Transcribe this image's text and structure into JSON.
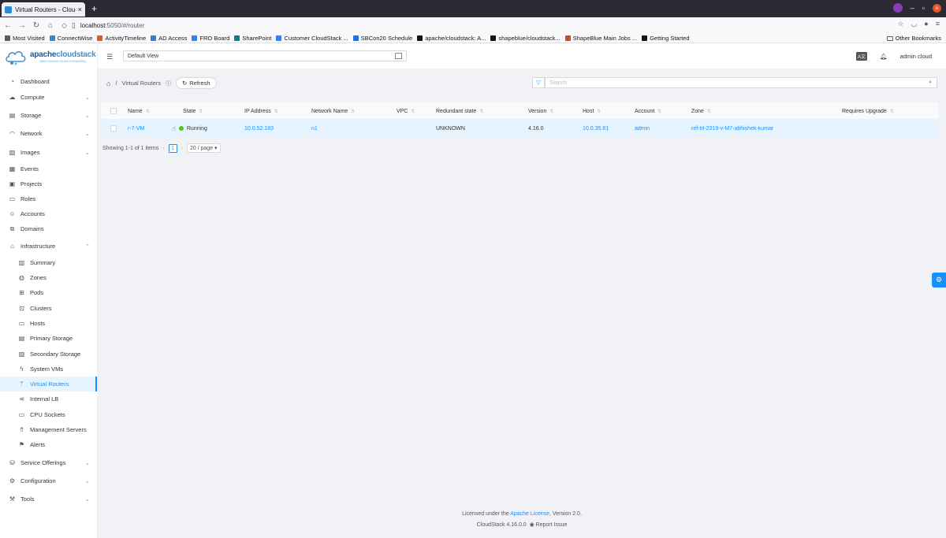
{
  "browser": {
    "tab_title": "Virtual Routers - CloudSt",
    "url_host": "localhost",
    "url_rest": ":5050/#/router",
    "bookmarks": [
      {
        "label": "Most Visited",
        "color": "#5b5b66"
      },
      {
        "label": "ConnectWise",
        "color": "#2a8dd4"
      },
      {
        "label": "ActivityTimeline",
        "color": "#e95420"
      },
      {
        "label": "AD Access",
        "color": "#3a7bd5"
      },
      {
        "label": "FRO Board",
        "color": "#2684ff"
      },
      {
        "label": "SharePoint",
        "color": "#038387"
      },
      {
        "label": "Customer CloudStack ...",
        "color": "#2684ff"
      },
      {
        "label": "SBCon20 Schedule",
        "color": "#1a73e8"
      },
      {
        "label": "apache/cloudstack: A...",
        "color": "#15141a"
      },
      {
        "label": "shapeblue/cloudstack...",
        "color": "#15141a"
      },
      {
        "label": "ShapeBlue Main Jobs ...",
        "color": "#d24726"
      },
      {
        "label": "Getting Started",
        "color": "#15141a"
      }
    ],
    "other_bookmarks": "Other Bookmarks"
  },
  "brand": {
    "logo_apache": "apache",
    "logo_cloudstack": "cloudstack",
    "logo_tagline": "open source cloud computing"
  },
  "header": {
    "view_label": "Default View",
    "user": "admin cloud",
    "lang_icon": "Ā"
  },
  "sidebar": {
    "items": [
      {
        "label": "Dashboard",
        "icon": "dashboard-icon",
        "glyph": "◔"
      },
      {
        "label": "Compute",
        "icon": "cloud-icon",
        "glyph": "☁"
      },
      {
        "label": "Storage",
        "icon": "database-icon",
        "glyph": "▤"
      },
      {
        "label": "Network",
        "icon": "wifi-icon",
        "glyph": "◠"
      },
      {
        "label": "Images",
        "icon": "picture-icon",
        "glyph": "▧"
      },
      {
        "label": "Events",
        "icon": "schedule-icon",
        "glyph": "▦"
      },
      {
        "label": "Projects",
        "icon": "project-icon",
        "glyph": "▣"
      },
      {
        "label": "Roles",
        "icon": "idcard-icon",
        "glyph": "▭"
      },
      {
        "label": "Accounts",
        "icon": "team-icon",
        "glyph": "☺"
      },
      {
        "label": "Domains",
        "icon": "block-icon",
        "glyph": "⧉"
      },
      {
        "label": "Infrastructure",
        "icon": "bank-icon",
        "glyph": "⌂"
      },
      {
        "label": "Summary",
        "icon": "read-icon",
        "glyph": "▥"
      },
      {
        "label": "Zones",
        "icon": "global-icon",
        "glyph": "◍"
      },
      {
        "label": "Pods",
        "icon": "appstore-icon",
        "glyph": "⊞"
      },
      {
        "label": "Clusters",
        "icon": "cluster-icon",
        "glyph": "⊡"
      },
      {
        "label": "Hosts",
        "icon": "desktop-icon",
        "glyph": "▭"
      },
      {
        "label": "Primary Storage",
        "icon": "primary-storage-icon",
        "glyph": "▤"
      },
      {
        "label": "Secondary Storage",
        "icon": "secondary-storage-icon",
        "glyph": "▨"
      },
      {
        "label": "System VMs",
        "icon": "thunderbolt-icon",
        "glyph": "ϟ"
      },
      {
        "label": "Virtual Routers",
        "icon": "fork-icon",
        "glyph": "ᛘ"
      },
      {
        "label": "Internal LB",
        "icon": "share-icon",
        "glyph": "⋖"
      },
      {
        "label": "CPU Sockets",
        "icon": "inbox-icon",
        "glyph": "▭"
      },
      {
        "label": "Management Servers",
        "icon": "rocket-icon",
        "glyph": "⇮"
      },
      {
        "label": "Alerts",
        "icon": "flag-icon",
        "glyph": "⚑"
      },
      {
        "label": "Service Offerings",
        "icon": "shopping-icon",
        "glyph": "⛁"
      },
      {
        "label": "Configuration",
        "icon": "setting-icon",
        "glyph": "⚙"
      },
      {
        "label": "Tools",
        "icon": "tool-icon",
        "glyph": "⚒"
      }
    ]
  },
  "page": {
    "breadcrumb_title": "Virtual Routers",
    "refresh_label": "Refresh",
    "search_placeholder": "Search"
  },
  "table": {
    "columns": [
      "Name",
      "State",
      "IP Address",
      "Network Name",
      "VPC",
      "Redundant state",
      "Version",
      "Host",
      "Account",
      "Zone",
      "Requires Upgrade"
    ],
    "rows": [
      {
        "name": "r-7-VM",
        "state": "Running",
        "ip": "10.0.52.183",
        "network": "n1",
        "vpc": "",
        "redundant": "UNKNOWN",
        "version": "4.16.0",
        "host": "10.0.35.81",
        "account": "admin",
        "zone": "ref-trl-2319-v-M7-abhishek-kumar",
        "requires_upgrade": ""
      }
    ]
  },
  "pagination": {
    "showing": "Showing 1-1 of 1 items",
    "current_page": "1",
    "page_size": "20 / page"
  },
  "footer": {
    "licensed_prefix": "Licensed under the",
    "license_link": "Apache License",
    "licensed_suffix": ", Version 2.0.",
    "version": "CloudStack 4.16.0.0",
    "report_issue": "Report Issue"
  }
}
